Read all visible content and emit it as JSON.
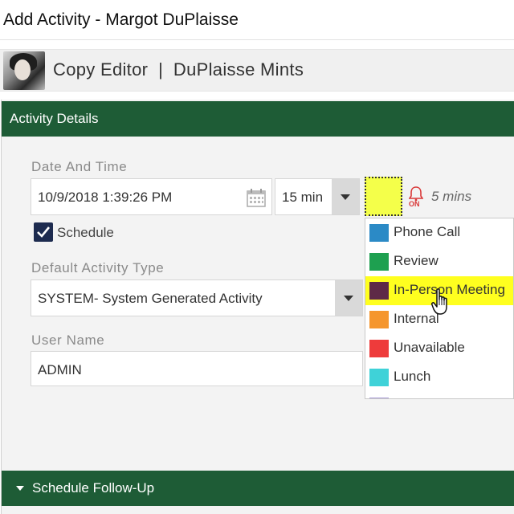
{
  "window": {
    "title": "Add Activity - Margot DuPlaisse"
  },
  "contact": {
    "role_company": "Copy Editor  |  DuPlaisse Mints"
  },
  "section": {
    "title": "Activity Details"
  },
  "date_time": {
    "label": "Date And Time",
    "value": "10/9/2018 1:39:26 PM",
    "duration": "15 min",
    "reminder_state": "ON",
    "reminder_text": "5 mins",
    "selected_color": "#f4ff4a"
  },
  "schedule": {
    "label": "Schedule",
    "checked": true
  },
  "activity_type": {
    "label": "Default Activity Type",
    "value": "SYSTEM- System Generated Activity"
  },
  "user": {
    "label": "User Name",
    "value": "ADMIN"
  },
  "color_options": [
    {
      "label": "Phone Call",
      "color": "#2b8ac6"
    },
    {
      "label": "Review",
      "color": "#1ea050"
    },
    {
      "label": "In-Person Meeting",
      "color": "#5e2a47",
      "highlighted": true
    },
    {
      "label": "Internal",
      "color": "#f5962d"
    },
    {
      "label": "Unavailable",
      "color": "#ee3b3b"
    },
    {
      "label": "Lunch",
      "color": "#3fd2d8"
    },
    {
      "label": "",
      "color": "#a99cd6"
    }
  ],
  "footer": {
    "title": "Schedule Follow-Up"
  }
}
